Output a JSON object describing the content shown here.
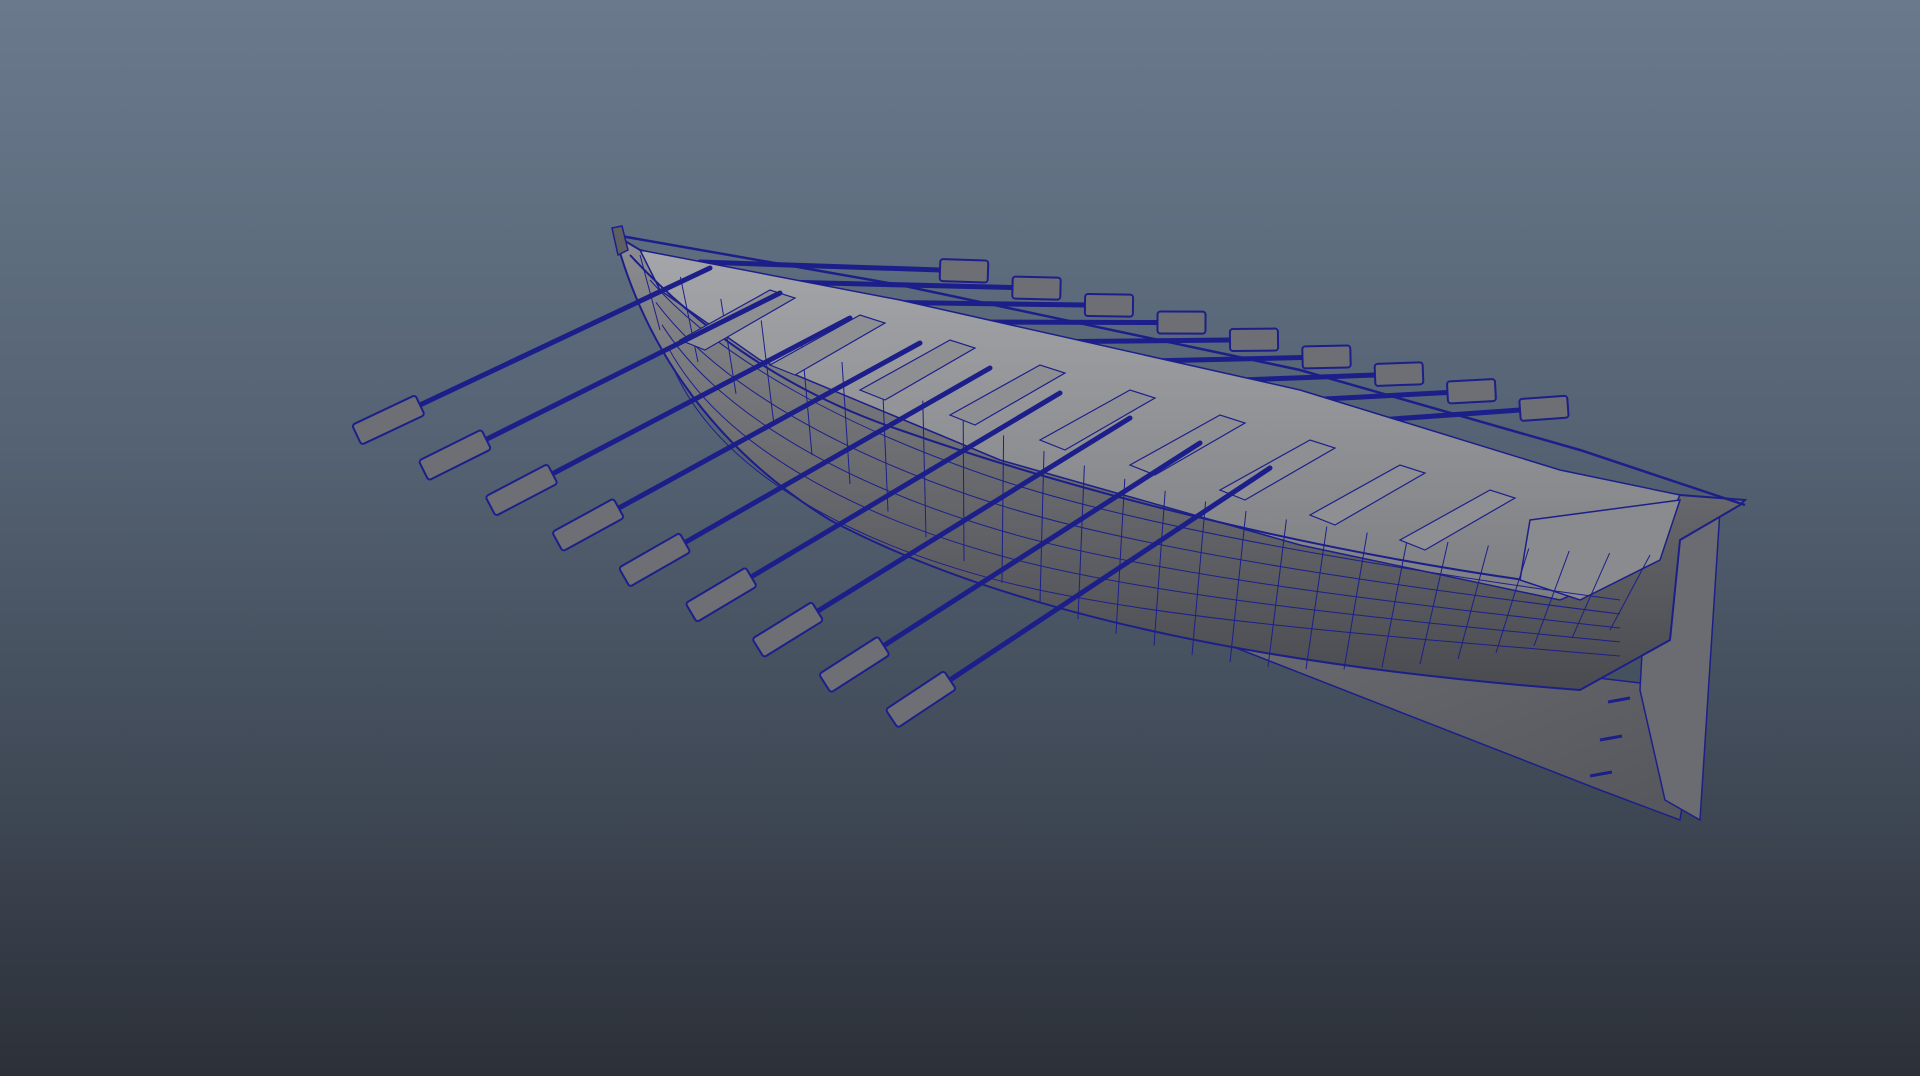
{
  "viewport": {
    "background_top": "#6a7a8c",
    "background_bottom": "#2c3038"
  },
  "model": {
    "object": "rowboat-with-oars",
    "hull_color": "#7e7f82",
    "hull_shadow": "#4d4e52",
    "interior_color": "#9a9b9f",
    "wire_color": "#1c1f8a",
    "oar_count_near_side": 9,
    "oar_count_far_side": 9
  }
}
